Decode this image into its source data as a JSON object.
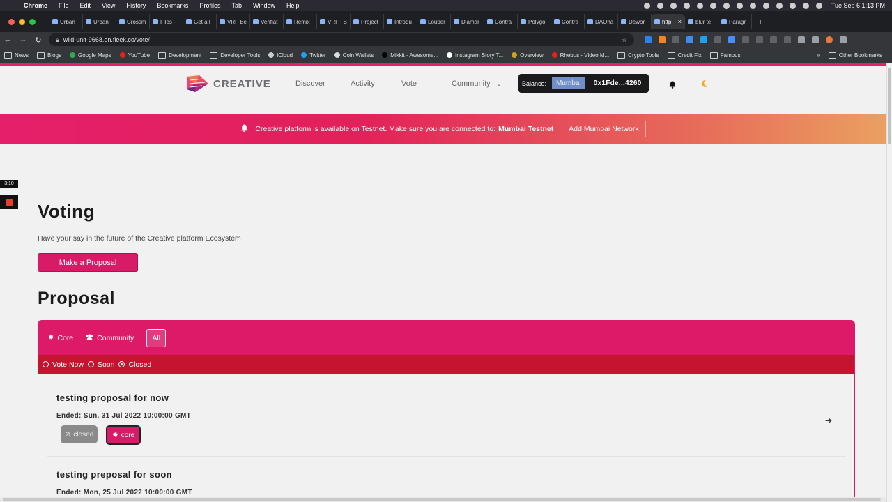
{
  "menubar": {
    "app": "Chrome",
    "items": [
      "File",
      "Edit",
      "View",
      "History",
      "Bookmarks",
      "Profiles",
      "Tab",
      "Window",
      "Help"
    ],
    "clock": "Tue Sep 6  1:13 PM"
  },
  "tabs": [
    {
      "label": "Urban"
    },
    {
      "label": "Urban"
    },
    {
      "label": "Crossm"
    },
    {
      "label": "Files -"
    },
    {
      "label": "Get a F"
    },
    {
      "label": "VRF Be"
    },
    {
      "label": "Verifiat"
    },
    {
      "label": "Remix"
    },
    {
      "label": "VRF | S"
    },
    {
      "label": "Project"
    },
    {
      "label": "Introdu"
    },
    {
      "label": "Louper"
    },
    {
      "label": "Diamar"
    },
    {
      "label": "Contra"
    },
    {
      "label": "Polygo"
    },
    {
      "label": "Contra"
    },
    {
      "label": "DAOha"
    },
    {
      "label": "Dewor"
    },
    {
      "label": "http",
      "active": true
    },
    {
      "label": "blur te"
    },
    {
      "label": "Paragr"
    }
  ],
  "address": {
    "url": "wild-unit-9668.on.fleek.co/vote/"
  },
  "bookmarks": [
    {
      "label": "News",
      "type": "folder"
    },
    {
      "label": "Blogs",
      "type": "folder"
    },
    {
      "label": "Google Maps",
      "color": "#34a853"
    },
    {
      "label": "YouTube",
      "color": "#e62117"
    },
    {
      "label": "Development",
      "type": "folder"
    },
    {
      "label": "Developer Tools",
      "type": "folder"
    },
    {
      "label": "iCloud",
      "color": "#cccccc"
    },
    {
      "label": "Twitter",
      "color": "#1da1f2"
    },
    {
      "label": "Coin Wallets",
      "color": "#dddddd"
    },
    {
      "label": "Mixkit - Awesome...",
      "color": "#000000"
    },
    {
      "label": "Instagram Story T...",
      "color": "#ffffff"
    },
    {
      "label": "Overview",
      "color": "#d4a017"
    },
    {
      "label": "Rhebus - Video M...",
      "color": "#e62117"
    },
    {
      "label": "Crypto Tools",
      "type": "folder"
    },
    {
      "label": "Credit Fix",
      "type": "folder"
    },
    {
      "label": "Famous",
      "type": "folder"
    }
  ],
  "bookmarks_more": "»",
  "bookmarks_other": "Other Bookmarks",
  "header": {
    "logo": "CREATIVE",
    "nav": [
      {
        "label": "Discover"
      },
      {
        "label": "Activity"
      },
      {
        "label": "Vote"
      },
      {
        "label": "Community"
      }
    ],
    "wallet": {
      "balance_label": "Balance:",
      "network": "Mumbai",
      "address": "0x1Fde...4260"
    }
  },
  "banner": {
    "text": "Creative platform is available on Testnet. Make sure you are connected to:",
    "network": "Mumbai Testnet",
    "button": "Add Mumbai Network"
  },
  "recorder": {
    "time": "3:10"
  },
  "main": {
    "title": "Voting",
    "subtitle": "Have your say in the future of the Creative platform Ecosystem",
    "make_proposal": "Make a Proposal",
    "proposal_title": "Proposal",
    "filters": [
      {
        "label": "Core"
      },
      {
        "label": "Community"
      },
      {
        "label": "All",
        "selected": true
      }
    ],
    "statuses": [
      {
        "label": "Vote Now",
        "selected": false
      },
      {
        "label": "Soon",
        "selected": false
      },
      {
        "label": "Closed",
        "selected": true
      }
    ],
    "proposals": [
      {
        "title": "testing proposal for now",
        "ended": "Ended: Sun, 31 Jul 2022 10:00:00 GMT",
        "status": "closed",
        "category": "core"
      },
      {
        "title": "testing preposal for soon",
        "ended": "Ended: Mon, 25 Jul 2022 10:00:00 GMT"
      }
    ]
  }
}
